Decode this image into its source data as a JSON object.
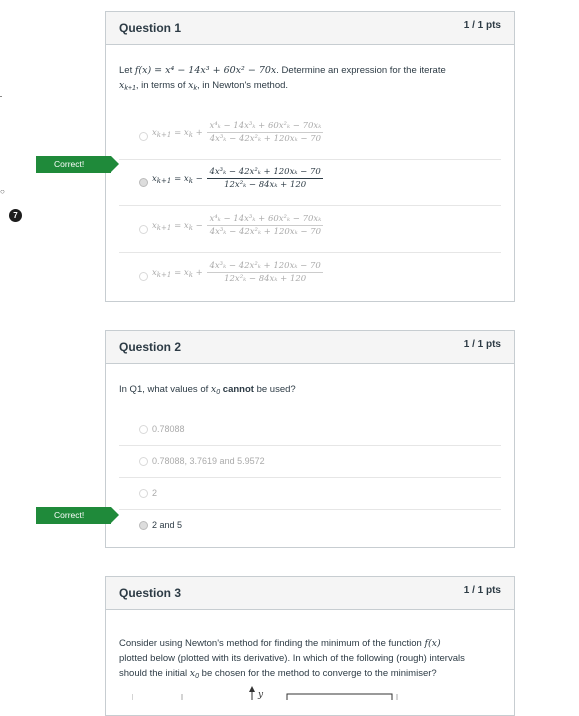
{
  "sidebar": {
    "badge": "7"
  },
  "q1": {
    "title": "Question 1",
    "points": "1 / 1 pts",
    "prompt_prefix": "Let ",
    "function": "f(x) = x⁴ − 14x³ + 60x² − 70x",
    "prompt_mid": ". Determine an expression for the iterate ",
    "iterate": "x",
    "iterate_sub": "k+1",
    "prompt_mid2": ", in terms of ",
    "term": "x",
    "term_sub": "k",
    "prompt_end": ", in Newton's method.",
    "answers": [
      {
        "lhs": "x",
        "lhs_sub": "k+1",
        "op": "= x",
        "op_sub": "k",
        "sign": "+",
        "num": "x⁴ₖ − 14x³ₖ + 60x²ₖ − 70xₖ",
        "den": "4x³ₖ − 42x²ₖ + 120xₖ − 70",
        "selected": false
      },
      {
        "lhs": "x",
        "lhs_sub": "k+1",
        "op": "= x",
        "op_sub": "k",
        "sign": "−",
        "num": "4x³ₖ − 42x²ₖ + 120xₖ − 70",
        "den": "12x²ₖ − 84xₖ + 120",
        "selected": true
      },
      {
        "lhs": "x",
        "lhs_sub": "k+1",
        "op": "= x",
        "op_sub": "k",
        "sign": "−",
        "num": "x⁴ₖ − 14x³ₖ + 60x²ₖ − 70xₖ",
        "den": "4x³ₖ − 42x²ₖ + 120xₖ − 70",
        "selected": false
      },
      {
        "lhs": "x",
        "lhs_sub": "k+1",
        "op": "= x",
        "op_sub": "k",
        "sign": "+",
        "num": "4x³ₖ − 42x²ₖ + 120xₖ − 70",
        "den": "12x²ₖ − 84xₖ + 120",
        "selected": false
      }
    ],
    "correct_label": "Correct!"
  },
  "q2": {
    "title": "Question 2",
    "points": "1 / 1 pts",
    "prompt_prefix": "In Q1, what values of ",
    "var": "x",
    "var_sub": "0",
    "prompt_bold": "cannot",
    "prompt_end": " be used?",
    "answers": [
      {
        "label": "0.78088",
        "selected": false
      },
      {
        "label": "0.78088, 3.7619 and 5.9572",
        "selected": false
      },
      {
        "label": "2",
        "selected": false
      },
      {
        "label": "2 and 5",
        "selected": true
      }
    ],
    "correct_label": "Correct!"
  },
  "q3": {
    "title": "Question 3",
    "points": "1 / 1 pts",
    "line1_prefix": "Consider using Newton's method for finding the minimum of the function ",
    "line1_fn": "f(x)",
    "line2": "plotted below (plotted with its derivative). In which of the following (rough) intervals",
    "line3_prefix": "should the initial ",
    "line3_var": "x",
    "line3_sub": "0",
    "line3_end": " be chosen for the method to converge to the minimiser?",
    "plot_y_label": "y"
  }
}
